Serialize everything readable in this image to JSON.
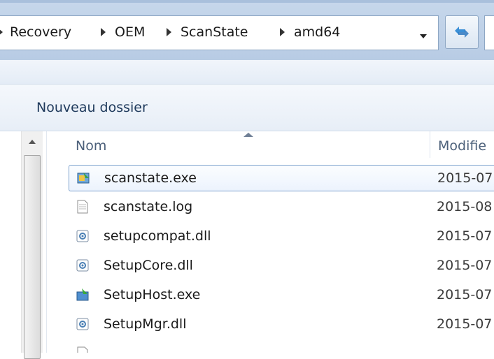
{
  "address_bar": {
    "breadcrumbs": [
      "Recovery",
      "OEM",
      "ScanState",
      "amd64"
    ],
    "refresh_icon": "refresh-icon"
  },
  "toolbar": {
    "new_folder_label": "Nouveau dossier"
  },
  "file_list": {
    "columns": {
      "name": "Nom",
      "date": "Modifie"
    },
    "rows": [
      {
        "name": "scanstate.exe",
        "date": "2015-07",
        "icon": "exe-app-icon",
        "selected": true
      },
      {
        "name": "scanstate.log",
        "date": "2015-08",
        "icon": "text-file-icon",
        "selected": false
      },
      {
        "name": "setupcompat.dll",
        "date": "2015-07",
        "icon": "dll-file-icon",
        "selected": false
      },
      {
        "name": "SetupCore.dll",
        "date": "2015-07",
        "icon": "dll-file-icon",
        "selected": false
      },
      {
        "name": "SetupHost.exe",
        "date": "2015-07",
        "icon": "setup-exe-icon",
        "selected": false
      },
      {
        "name": "SetupMgr.dll",
        "date": "2015-07",
        "icon": "dll-file-icon",
        "selected": false
      }
    ]
  }
}
